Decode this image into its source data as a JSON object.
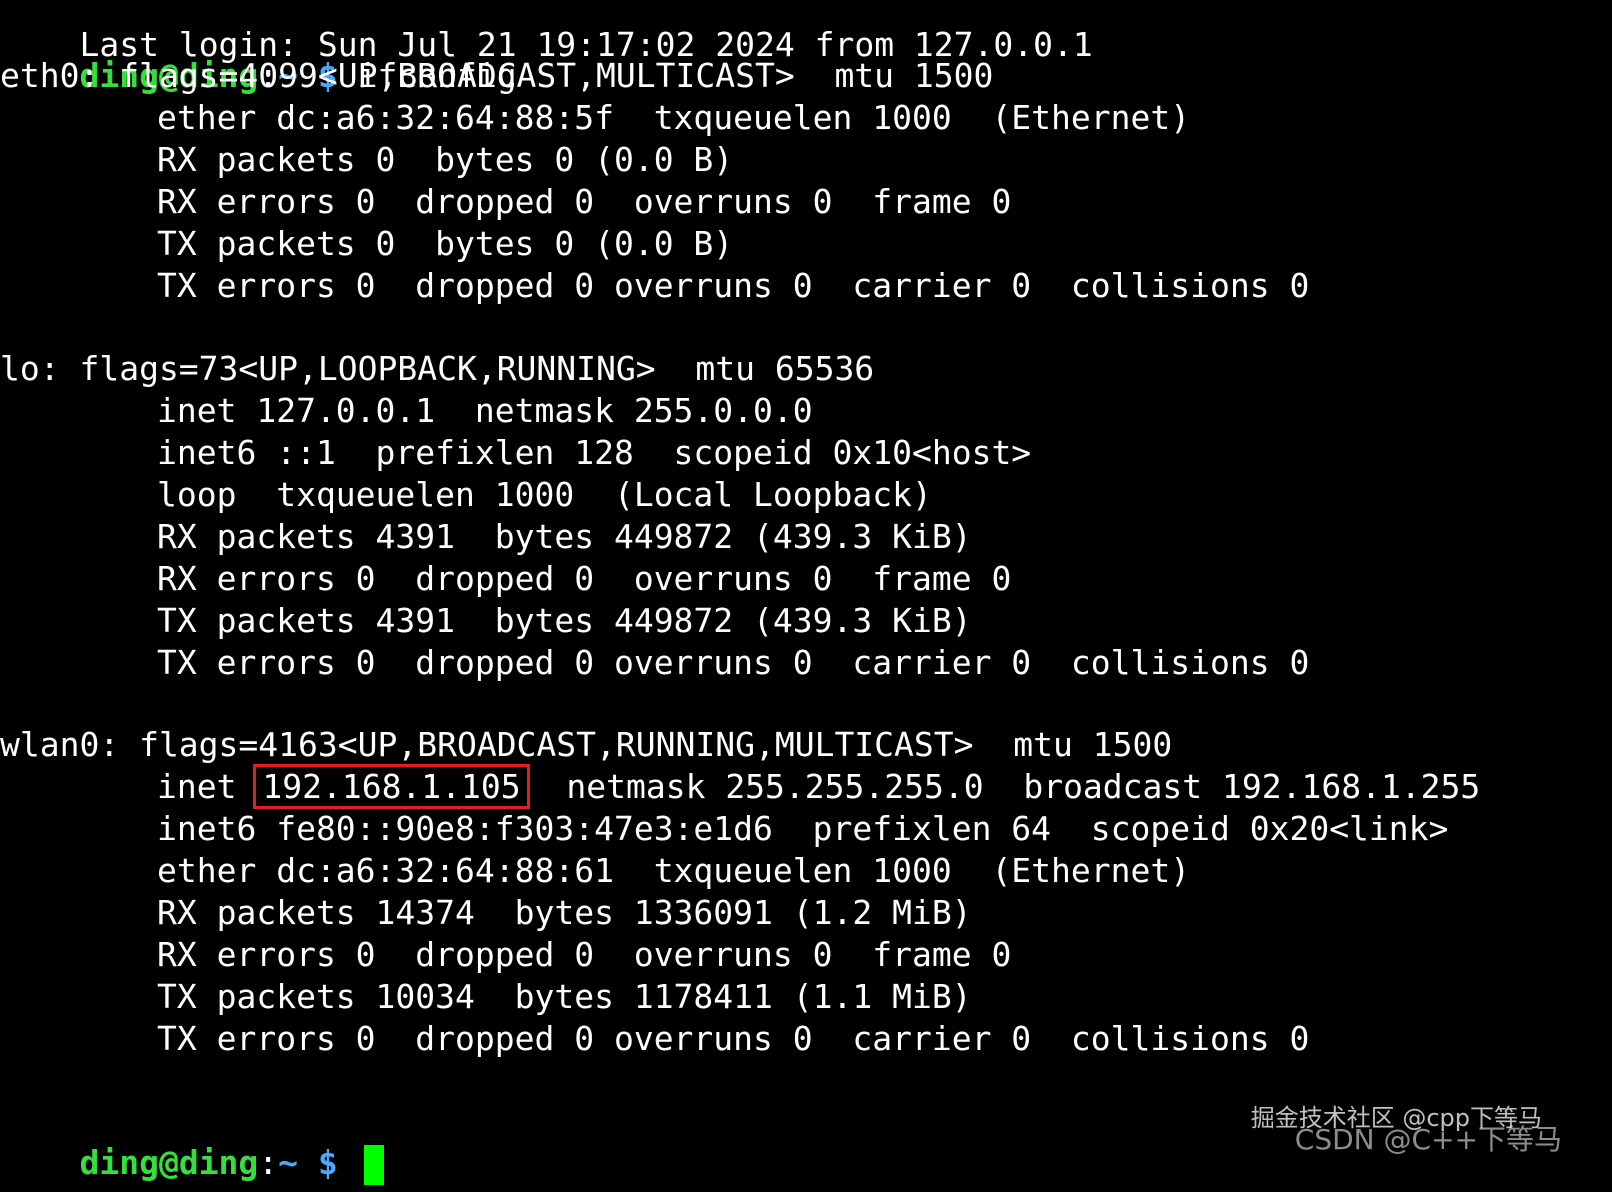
{
  "colors": {
    "background": "#000000",
    "text": "#ffffff",
    "prompt_user": "#35e03a",
    "prompt_path": "#4aa8ff",
    "highlight_box": "#e02020",
    "cursor": "#00ff00"
  },
  "top_partial_line": "Last login: Sun Jul 21 19:17:02 2024 from 127.0.0.1",
  "prompt": {
    "user_host": "ding@ding",
    "colon": ":",
    "path": "~",
    "dollar": " $ ",
    "command": "ifconfig"
  },
  "eth0": {
    "header": "eth0: flags=4099<UP,BROADCAST,MULTICAST>  mtu 1500",
    "lines": [
      "ether dc:a6:32:64:88:5f  txqueuelen 1000  (Ethernet)",
      "RX packets 0  bytes 0 (0.0 B)",
      "RX errors 0  dropped 0  overruns 0  frame 0",
      "TX packets 0  bytes 0 (0.0 B)",
      "TX errors 0  dropped 0 overruns 0  carrier 0  collisions 0"
    ]
  },
  "lo": {
    "header": "lo: flags=73<UP,LOOPBACK,RUNNING>  mtu 65536",
    "lines": [
      "inet 127.0.0.1  netmask 255.0.0.0",
      "inet6 ::1  prefixlen 128  scopeid 0x10<host>",
      "loop  txqueuelen 1000  (Local Loopback)",
      "RX packets 4391  bytes 449872 (439.3 KiB)",
      "RX errors 0  dropped 0  overruns 0  frame 0",
      "TX packets 4391  bytes 449872 (439.3 KiB)",
      "TX errors 0  dropped 0 overruns 0  carrier 0  collisions 0"
    ]
  },
  "wlan0": {
    "header": "wlan0: flags=4163<UP,BROADCAST,RUNNING,MULTICAST>  mtu 1500",
    "inet_label": "inet",
    "inet_addr": "192.168.1.105",
    "inet_rest": "  netmask 255.255.255.0  broadcast 192.168.1.255",
    "lines": [
      "inet6 fe80::90e8:f303:47e3:e1d6  prefixlen 64  scopeid 0x20<link>",
      "ether dc:a6:32:64:88:61  txqueuelen 1000  (Ethernet)",
      "RX packets 14374  bytes 1336091 (1.2 MiB)",
      "RX errors 0  dropped 0  overruns 0  frame 0",
      "TX packets 10034  bytes 1178411 (1.1 MiB)",
      "TX errors 0  dropped 0 overruns 0  carrier 0  collisions 0"
    ]
  },
  "watermarks": {
    "juejin": "掘金技术社区 @cpp下等马",
    "csdn": "CSDN @C++下等马"
  }
}
